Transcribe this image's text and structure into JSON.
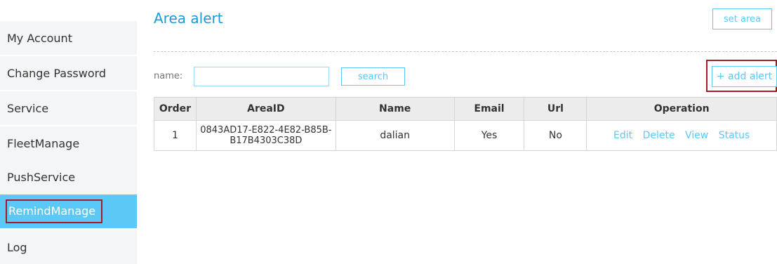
{
  "sidebar": {
    "items": [
      {
        "label": "My Account"
      },
      {
        "label": "Change Password"
      },
      {
        "label": "Service"
      },
      {
        "label": "FleetManage"
      },
      {
        "label": "PushService"
      },
      {
        "label": "RemindManage"
      },
      {
        "label": "Log"
      }
    ],
    "active_index": 5
  },
  "header": {
    "title": "Area alert",
    "set_area_label": "set area"
  },
  "filter": {
    "name_label": "name:",
    "name_value": "",
    "search_label": "search",
    "add_label": "+ add alert"
  },
  "table": {
    "headers": {
      "order": "Order",
      "area_id": "AreaID",
      "name": "Name",
      "email": "Email",
      "url": "Url",
      "operation": "Operation"
    },
    "rows": [
      {
        "order": "1",
        "area_id_line1": "0843AD17-E822-4E82-B85B-",
        "area_id_line2": "B17B4303C38D",
        "name": "dalian",
        "email": "Yes",
        "url": "No",
        "ops": {
          "edit": "Edit",
          "delete": "Delete",
          "view": "View",
          "status": "Status"
        }
      }
    ]
  },
  "colors": {
    "accent": "#5bc8f5",
    "title": "#1c9ad6",
    "highlight_border": "#a21c24",
    "sidebar_bg": "#f4f5f7"
  }
}
